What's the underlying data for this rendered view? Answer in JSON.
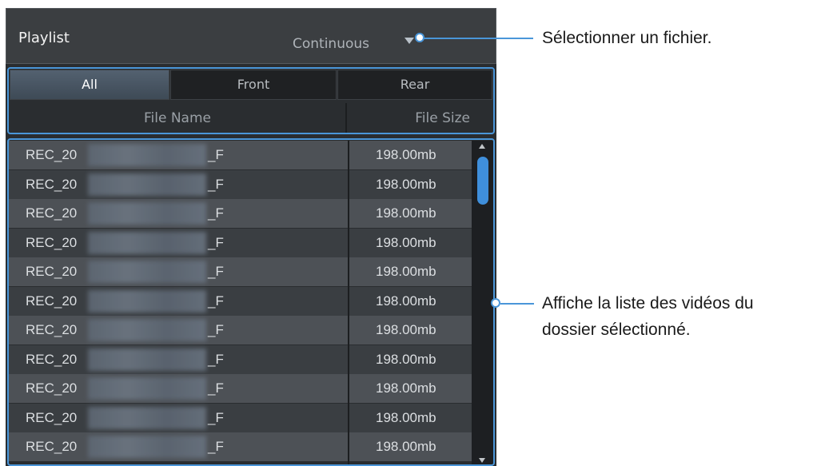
{
  "header": {
    "title": "Playlist",
    "playback_mode": "Continuous"
  },
  "tabs": [
    {
      "label": "All",
      "active": true
    },
    {
      "label": "Front",
      "active": false
    },
    {
      "label": "Rear",
      "active": false
    }
  ],
  "columns": {
    "file_name": "File Name",
    "file_size": "File Size"
  },
  "rows": [
    {
      "prefix": "REC_20",
      "suffix": "_F",
      "size": "198.00mb"
    },
    {
      "prefix": "REC_20",
      "suffix": "_F",
      "size": "198.00mb"
    },
    {
      "prefix": "REC_20",
      "suffix": "_F",
      "size": "198.00mb"
    },
    {
      "prefix": "REC_20",
      "suffix": "_F",
      "size": "198.00mb"
    },
    {
      "prefix": "REC_20",
      "suffix": "_F",
      "size": "198.00mb"
    },
    {
      "prefix": "REC_20",
      "suffix": "_F",
      "size": "198.00mb"
    },
    {
      "prefix": "REC_20",
      "suffix": "_F",
      "size": "198.00mb"
    },
    {
      "prefix": "REC_20",
      "suffix": "_F",
      "size": "198.00mb"
    },
    {
      "prefix": "REC_20",
      "suffix": "_F",
      "size": "198.00mb"
    },
    {
      "prefix": "REC_20",
      "suffix": "_F",
      "size": "198.00mb"
    },
    {
      "prefix": "REC_20",
      "suffix": "_F",
      "size": "198.00mb"
    }
  ],
  "callouts": {
    "select_file": "Sélectionner un fichier.",
    "list_line1": "Affiche la liste des vidéos du",
    "list_line2": "dossier sélectionné."
  },
  "icons": {
    "dropdown": "chevron-down-icon",
    "scroll_up": "scroll-up-icon",
    "scroll_down": "scroll-down-icon"
  },
  "colors": {
    "accent": "#4a96d9",
    "scroll_thumb": "#3f8fdc"
  }
}
